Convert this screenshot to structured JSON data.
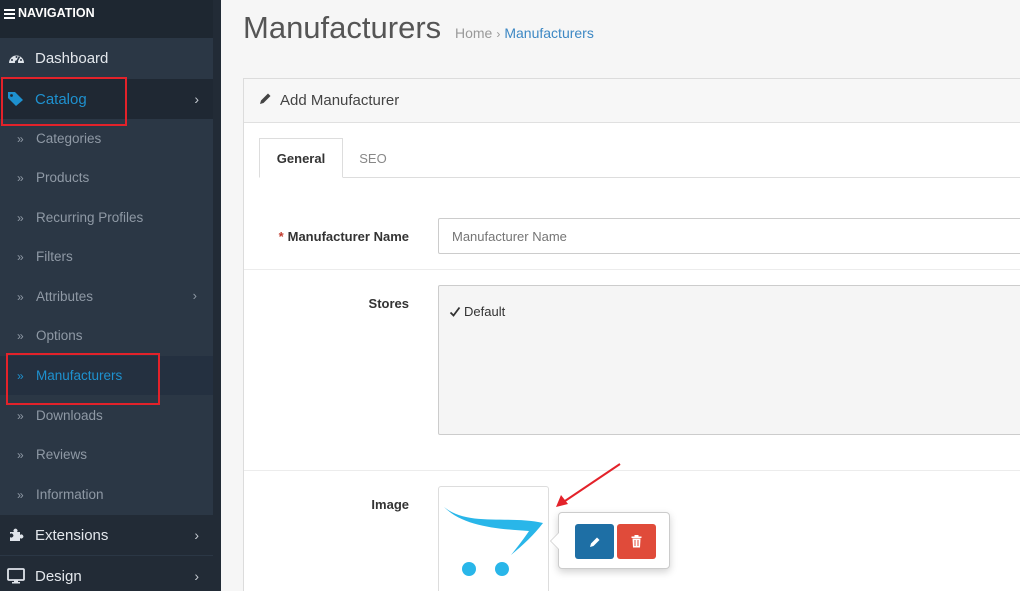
{
  "sidebar": {
    "header": "NAVIGATION",
    "top_items": [
      {
        "label": "Dashboard",
        "icon": "dashboard-icon"
      },
      {
        "label": "Catalog",
        "icon": "tag-icon",
        "active": true
      },
      {
        "label": "Extensions",
        "icon": "puzzle-icon"
      },
      {
        "label": "Design",
        "icon": "monitor-icon"
      }
    ],
    "catalog_items": [
      {
        "label": "Categories"
      },
      {
        "label": "Products"
      },
      {
        "label": "Recurring Profiles"
      },
      {
        "label": "Filters"
      },
      {
        "label": "Attributes",
        "has_children": true
      },
      {
        "label": "Options"
      },
      {
        "label": "Manufacturers",
        "active": true
      },
      {
        "label": "Downloads"
      },
      {
        "label": "Reviews"
      },
      {
        "label": "Information"
      }
    ]
  },
  "page": {
    "title": "Manufacturers",
    "breadcrumb": [
      "Home",
      "Manufacturers"
    ]
  },
  "panel": {
    "heading": "Add Manufacturer",
    "tabs": [
      "General",
      "SEO"
    ],
    "fields": {
      "name_label": "Manufacturer Name",
      "name_required": "*",
      "name_placeholder": "Manufacturer Name",
      "stores_label": "Stores",
      "store_option": "Default",
      "store_checked": true,
      "image_label": "Image"
    }
  },
  "colors": {
    "sidebar_bg": "#2b3745",
    "accent": "#1e91cf",
    "edit_button": "#1e6fa5",
    "delete_button": "#e04b3a",
    "annotation": "#e3222a"
  }
}
